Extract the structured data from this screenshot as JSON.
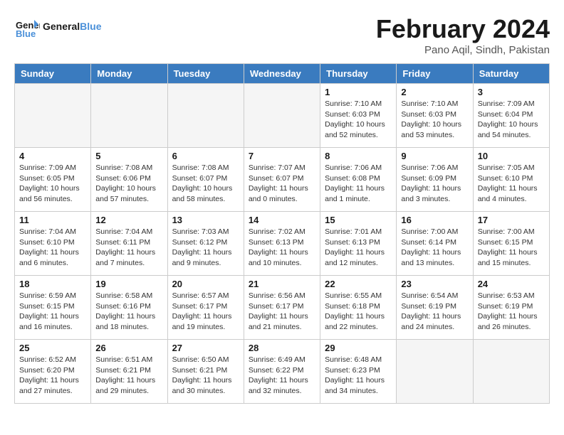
{
  "header": {
    "logo_text_general": "General",
    "logo_text_blue": "Blue",
    "month_title": "February 2024",
    "location": "Pano Aqil, Sindh, Pakistan"
  },
  "days_of_week": [
    "Sunday",
    "Monday",
    "Tuesday",
    "Wednesday",
    "Thursday",
    "Friday",
    "Saturday"
  ],
  "weeks": [
    [
      {
        "day": "",
        "info": ""
      },
      {
        "day": "",
        "info": ""
      },
      {
        "day": "",
        "info": ""
      },
      {
        "day": "",
        "info": ""
      },
      {
        "day": "1",
        "info": "Sunrise: 7:10 AM\nSunset: 6:03 PM\nDaylight: 10 hours\nand 52 minutes."
      },
      {
        "day": "2",
        "info": "Sunrise: 7:10 AM\nSunset: 6:03 PM\nDaylight: 10 hours\nand 53 minutes."
      },
      {
        "day": "3",
        "info": "Sunrise: 7:09 AM\nSunset: 6:04 PM\nDaylight: 10 hours\nand 54 minutes."
      }
    ],
    [
      {
        "day": "4",
        "info": "Sunrise: 7:09 AM\nSunset: 6:05 PM\nDaylight: 10 hours\nand 56 minutes."
      },
      {
        "day": "5",
        "info": "Sunrise: 7:08 AM\nSunset: 6:06 PM\nDaylight: 10 hours\nand 57 minutes."
      },
      {
        "day": "6",
        "info": "Sunrise: 7:08 AM\nSunset: 6:07 PM\nDaylight: 10 hours\nand 58 minutes."
      },
      {
        "day": "7",
        "info": "Sunrise: 7:07 AM\nSunset: 6:07 PM\nDaylight: 11 hours\nand 0 minutes."
      },
      {
        "day": "8",
        "info": "Sunrise: 7:06 AM\nSunset: 6:08 PM\nDaylight: 11 hours\nand 1 minute."
      },
      {
        "day": "9",
        "info": "Sunrise: 7:06 AM\nSunset: 6:09 PM\nDaylight: 11 hours\nand 3 minutes."
      },
      {
        "day": "10",
        "info": "Sunrise: 7:05 AM\nSunset: 6:10 PM\nDaylight: 11 hours\nand 4 minutes."
      }
    ],
    [
      {
        "day": "11",
        "info": "Sunrise: 7:04 AM\nSunset: 6:10 PM\nDaylight: 11 hours\nand 6 minutes."
      },
      {
        "day": "12",
        "info": "Sunrise: 7:04 AM\nSunset: 6:11 PM\nDaylight: 11 hours\nand 7 minutes."
      },
      {
        "day": "13",
        "info": "Sunrise: 7:03 AM\nSunset: 6:12 PM\nDaylight: 11 hours\nand 9 minutes."
      },
      {
        "day": "14",
        "info": "Sunrise: 7:02 AM\nSunset: 6:13 PM\nDaylight: 11 hours\nand 10 minutes."
      },
      {
        "day": "15",
        "info": "Sunrise: 7:01 AM\nSunset: 6:13 PM\nDaylight: 11 hours\nand 12 minutes."
      },
      {
        "day": "16",
        "info": "Sunrise: 7:00 AM\nSunset: 6:14 PM\nDaylight: 11 hours\nand 13 minutes."
      },
      {
        "day": "17",
        "info": "Sunrise: 7:00 AM\nSunset: 6:15 PM\nDaylight: 11 hours\nand 15 minutes."
      }
    ],
    [
      {
        "day": "18",
        "info": "Sunrise: 6:59 AM\nSunset: 6:15 PM\nDaylight: 11 hours\nand 16 minutes."
      },
      {
        "day": "19",
        "info": "Sunrise: 6:58 AM\nSunset: 6:16 PM\nDaylight: 11 hours\nand 18 minutes."
      },
      {
        "day": "20",
        "info": "Sunrise: 6:57 AM\nSunset: 6:17 PM\nDaylight: 11 hours\nand 19 minutes."
      },
      {
        "day": "21",
        "info": "Sunrise: 6:56 AM\nSunset: 6:17 PM\nDaylight: 11 hours\nand 21 minutes."
      },
      {
        "day": "22",
        "info": "Sunrise: 6:55 AM\nSunset: 6:18 PM\nDaylight: 11 hours\nand 22 minutes."
      },
      {
        "day": "23",
        "info": "Sunrise: 6:54 AM\nSunset: 6:19 PM\nDaylight: 11 hours\nand 24 minutes."
      },
      {
        "day": "24",
        "info": "Sunrise: 6:53 AM\nSunset: 6:19 PM\nDaylight: 11 hours\nand 26 minutes."
      }
    ],
    [
      {
        "day": "25",
        "info": "Sunrise: 6:52 AM\nSunset: 6:20 PM\nDaylight: 11 hours\nand 27 minutes."
      },
      {
        "day": "26",
        "info": "Sunrise: 6:51 AM\nSunset: 6:21 PM\nDaylight: 11 hours\nand 29 minutes."
      },
      {
        "day": "27",
        "info": "Sunrise: 6:50 AM\nSunset: 6:21 PM\nDaylight: 11 hours\nand 30 minutes."
      },
      {
        "day": "28",
        "info": "Sunrise: 6:49 AM\nSunset: 6:22 PM\nDaylight: 11 hours\nand 32 minutes."
      },
      {
        "day": "29",
        "info": "Sunrise: 6:48 AM\nSunset: 6:23 PM\nDaylight: 11 hours\nand 34 minutes."
      },
      {
        "day": "",
        "info": ""
      },
      {
        "day": "",
        "info": ""
      }
    ]
  ]
}
